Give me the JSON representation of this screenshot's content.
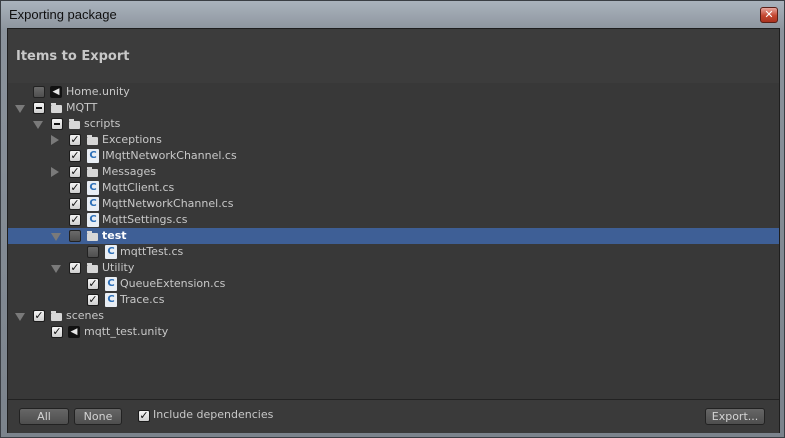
{
  "window": {
    "title": "Exporting package",
    "close_glyph": "✕"
  },
  "header": {
    "title": "Items to Export"
  },
  "tree": [
    {
      "label": "Home.unity",
      "icon": "unity-scene-icon",
      "indent": 0,
      "foldout": "none",
      "check": "unchecked",
      "selected": false
    },
    {
      "label": "MQTT",
      "icon": "folder-icon",
      "indent": 0,
      "foldout": "open",
      "check": "mixed",
      "selected": false
    },
    {
      "label": "scripts",
      "icon": "folder-icon",
      "indent": 1,
      "foldout": "open",
      "check": "mixed",
      "selected": false
    },
    {
      "label": "Exceptions",
      "icon": "folder-icon",
      "indent": 2,
      "foldout": "closed",
      "check": "checked",
      "selected": false
    },
    {
      "label": "IMqttNetworkChannel.cs",
      "icon": "csharp-script-icon",
      "indent": 2,
      "foldout": "none",
      "check": "checked",
      "selected": false
    },
    {
      "label": "Messages",
      "icon": "folder-icon",
      "indent": 2,
      "foldout": "closed",
      "check": "checked",
      "selected": false
    },
    {
      "label": "MqttClient.cs",
      "icon": "csharp-script-icon",
      "indent": 2,
      "foldout": "none",
      "check": "checked",
      "selected": false
    },
    {
      "label": "MqttNetworkChannel.cs",
      "icon": "csharp-script-icon",
      "indent": 2,
      "foldout": "none",
      "check": "checked",
      "selected": false
    },
    {
      "label": "MqttSettings.cs",
      "icon": "csharp-script-icon",
      "indent": 2,
      "foldout": "none",
      "check": "checked",
      "selected": false
    },
    {
      "label": "test",
      "icon": "folder-icon",
      "indent": 2,
      "foldout": "open",
      "check": "unchecked",
      "selected": true
    },
    {
      "label": "mqttTest.cs",
      "icon": "csharp-script-icon",
      "indent": 3,
      "foldout": "none",
      "check": "unchecked",
      "selected": false
    },
    {
      "label": "Utility",
      "icon": "folder-icon",
      "indent": 2,
      "foldout": "open",
      "check": "checked",
      "selected": false
    },
    {
      "label": "QueueExtension.cs",
      "icon": "csharp-script-icon",
      "indent": 3,
      "foldout": "none",
      "check": "checked",
      "selected": false
    },
    {
      "label": "Trace.cs",
      "icon": "csharp-script-icon",
      "indent": 3,
      "foldout": "none",
      "check": "checked",
      "selected": false
    },
    {
      "label": "scenes",
      "icon": "folder-icon",
      "indent": 0,
      "foldout": "open",
      "check": "checked",
      "selected": false
    },
    {
      "label": "mqtt_test.unity",
      "icon": "unity-scene-icon",
      "indent": 1,
      "foldout": "none",
      "check": "checked",
      "selected": false
    }
  ],
  "footer": {
    "all_label": "All",
    "none_label": "None",
    "include_dependencies_label": "Include dependencies",
    "include_dependencies_checked": true,
    "export_label": "Export..."
  }
}
